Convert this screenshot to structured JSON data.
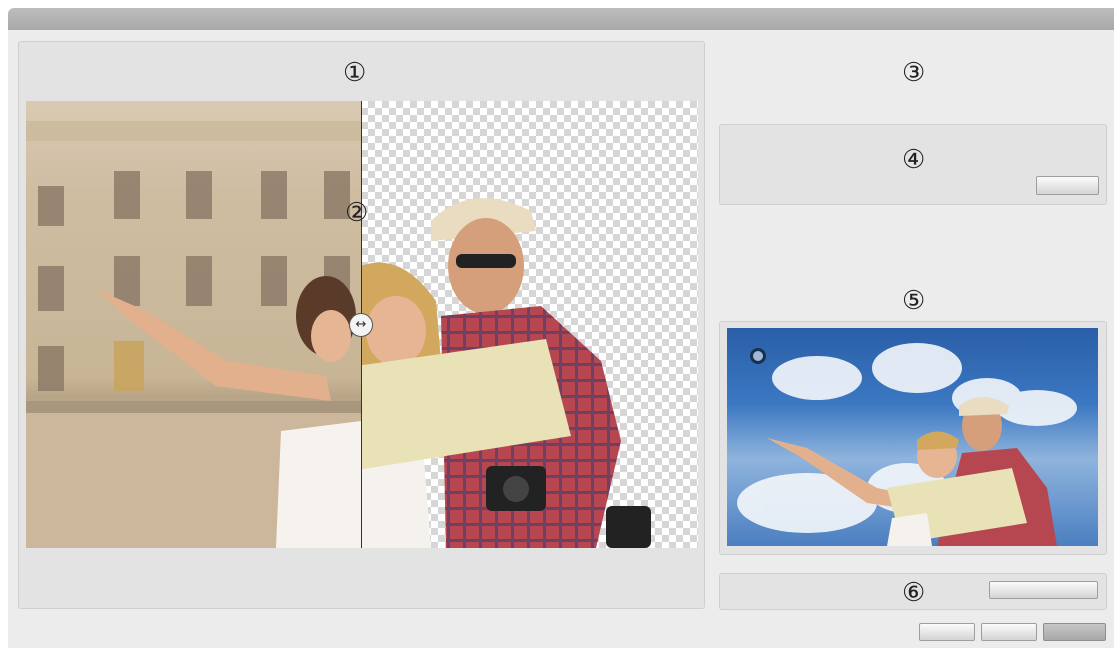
{
  "window": {
    "title": ""
  },
  "markers": {
    "m1": "①",
    "m2": "②",
    "m3": "③",
    "m4": "④",
    "m5": "⑤",
    "m6": "⑥"
  },
  "slider_icon": "↔",
  "icons": {
    "compare_handle": "horizontal-arrows-icon",
    "color_picker": "eyedropper-ring-icon"
  },
  "colors": {
    "panel": "#e3e3e3",
    "window": "#ececec",
    "titlebar": "#aaaaaa"
  }
}
